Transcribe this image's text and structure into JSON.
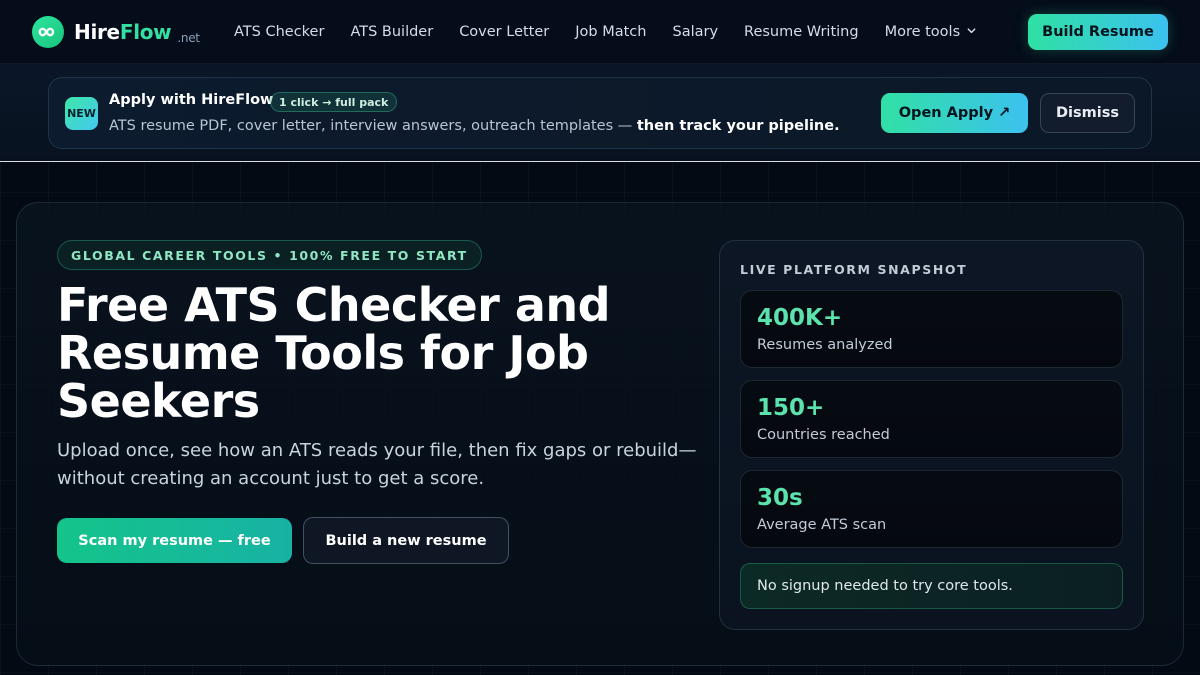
{
  "nav": {
    "logo": {
      "hire": "Hire",
      "flow": "Flow",
      "tld": ".net"
    },
    "links": [
      "ATS Checker",
      "ATS Builder",
      "Cover Letter",
      "Job Match",
      "Salary",
      "Resume Writing"
    ],
    "more": "More tools",
    "cta": "Build Resume"
  },
  "announcement": {
    "badge": "NEW",
    "title": "Apply with HireFlow",
    "pill": "1 click → full pack",
    "description": "ATS resume PDF, cover letter, interview answers, outreach templates — ",
    "description_bold": "then track your pipeline.",
    "open_button": "Open Apply ↗",
    "dismiss_button": "Dismiss"
  },
  "hero": {
    "eyebrow": "GLOBAL CAREER TOOLS • 100% FREE TO START",
    "title": "Free ATS Checker and Resume Tools for Job Seekers",
    "subtitle": "Upload once, see how an ATS reads your file, then fix gaps or rebuild—without creating an account just to get a score.",
    "primary_button": "Scan my resume — free",
    "secondary_button": "Build a new resume"
  },
  "snapshot": {
    "label": "LIVE PLATFORM SNAPSHOT",
    "stats": [
      {
        "value": "400K+",
        "label": "Resumes analyzed"
      },
      {
        "value": "150+",
        "label": "Countries reached"
      },
      {
        "value": "30s",
        "label": "Average ATS scan"
      }
    ],
    "note": "No signup needed to try core tools."
  },
  "colors": {
    "accent_green": "#34e0a1",
    "accent_cyan": "#3cc2f0",
    "background": "#040a13"
  }
}
